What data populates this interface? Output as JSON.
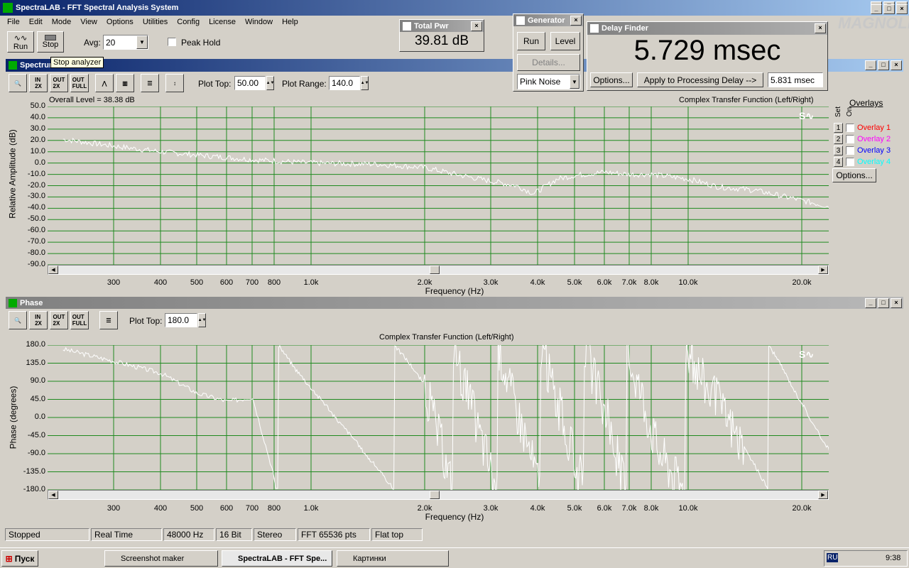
{
  "app": {
    "title": "SpectraLAB - FFT Spectral Analysis System"
  },
  "menu": [
    "File",
    "Edit",
    "Mode",
    "View",
    "Options",
    "Utilities",
    "Config",
    "License",
    "Window",
    "Help"
  ],
  "toolbar": {
    "run_label": "Run",
    "stop_label": "Stop",
    "avg_label": "Avg:",
    "avg_value": "20",
    "peak_hold_label": "Peak Hold",
    "tooltip": "Stop analyzer"
  },
  "total_pwr": {
    "title": "Total Pwr",
    "value": "39.81 dB"
  },
  "generator": {
    "title": "Generator",
    "run": "Run",
    "level": "Level",
    "details": "Details...",
    "signal": "Pink Noise"
  },
  "delay_finder": {
    "title": "Delay Finder",
    "value": "5.729 msec",
    "options": "Options...",
    "apply": "Apply to Processing Delay -->",
    "delay_value": "5.831 msec"
  },
  "watermark": "MAGNOLIA",
  "spectrum": {
    "title": "Spectrum",
    "plot_top_label": "Plot Top:",
    "plot_top": "50.00",
    "plot_range_label": "Plot Range:",
    "plot_range": "140.0",
    "overall_level": "Overall Level = 38.38 dB",
    "header": "Complex Transfer Function (Left/Right)",
    "ylabel": "Relative Amplitude (dB)",
    "xlabel": "Frequency (Hz)",
    "yticks": [
      "50.0",
      "40.0",
      "30.0",
      "20.0",
      "10.0",
      "0.0",
      "-10.0",
      "-20.0",
      "-30.0",
      "-40.0",
      "-50.0",
      "-60.0",
      "-70.0",
      "-80.0",
      "-90.0"
    ],
    "xticks": [
      "300",
      "400",
      "500",
      "600",
      "700",
      "800",
      "1.0k",
      "2.0k",
      "3.0k",
      "4.0k",
      "5.0k",
      "6.0k",
      "7.0k",
      "8.0k",
      "10.0k",
      "20.0k"
    ]
  },
  "overlays": {
    "title": "Overlays",
    "set": "Set",
    "on": "On",
    "items": [
      {
        "num": "1",
        "label": "Overlay 1",
        "color": "#ff0000"
      },
      {
        "num": "2",
        "label": "Overlay 2",
        "color": "#ff00ff"
      },
      {
        "num": "3",
        "label": "Overlay 3",
        "color": "#0000ff"
      },
      {
        "num": "4",
        "label": "Overlay 4",
        "color": "#00ffff"
      }
    ],
    "options": "Options..."
  },
  "phase": {
    "title": "Phase",
    "plot_top_label": "Plot Top:",
    "plot_top": "180.0",
    "header": "Complex Transfer Function (Left/Right)",
    "ylabel": "Phase (degrees)",
    "xlabel": "Frequency (Hz)",
    "yticks": [
      "180.0",
      "135.0",
      "90.0",
      "45.0",
      "0.0",
      "-45.0",
      "-90.0",
      "-135.0",
      "-180.0"
    ],
    "xticks": [
      "300",
      "400",
      "500",
      "600",
      "700",
      "800",
      "1.0k",
      "2.0k",
      "3.0k",
      "4.0k",
      "5.0k",
      "6.0k",
      "7.0k",
      "8.0k",
      "10.0k",
      "20.0k"
    ]
  },
  "statusbar": [
    "Stopped",
    "Real Time",
    "48000 Hz",
    "16 Bit",
    "Stereo",
    "FFT 65536 pts",
    "Flat top"
  ],
  "taskbar": {
    "start": "Пуск",
    "items": [
      "Screenshot maker",
      "SpectraLAB - FFT Spe...",
      "Картинки"
    ],
    "lang": "RU",
    "clock": "9:38"
  },
  "chart_data": [
    {
      "type": "line",
      "title": "Complex Transfer Function (Left/Right)",
      "xlabel": "Frequency (Hz)",
      "ylabel": "Relative Amplitude (dB)",
      "ylim": [
        -90,
        50
      ],
      "x_scale": "log",
      "series": [
        {
          "values_x": [
            220,
            300,
            400,
            500,
            700,
            1000,
            1500,
            2000,
            2500,
            3000,
            3500,
            3900,
            4500,
            5000,
            6000,
            7000,
            8000,
            10000,
            12000,
            15000,
            20000,
            24000
          ],
          "values_y": [
            21,
            15,
            10,
            7,
            3,
            0,
            -1,
            -4,
            -11,
            -16,
            -20,
            -27,
            -14,
            -11,
            -8,
            -10,
            -10,
            -14,
            -21,
            -24,
            -33,
            -39
          ]
        }
      ]
    },
    {
      "type": "line",
      "title": "Complex Transfer Function (Left/Right)",
      "xlabel": "Frequency (Hz)",
      "ylabel": "Phase (degrees)",
      "ylim": [
        -180,
        180
      ],
      "x_scale": "log",
      "series": [
        {
          "values_x": [
            220,
            300,
            400,
            500,
            600,
            700,
            800
          ],
          "values_y": [
            170,
            140,
            110,
            60,
            40,
            50,
            -150
          ]
        }
      ]
    }
  ]
}
